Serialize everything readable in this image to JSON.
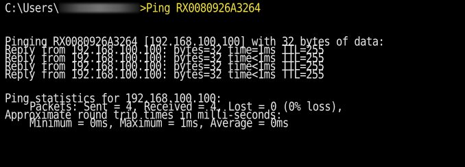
{
  "colors": {
    "background": "#000000",
    "text": "#e6e6e6",
    "command": "#f2e03a"
  },
  "prompt": {
    "path_prefix": "C:\\Users\\",
    "separator": ">",
    "command": "Ping RX0080926A3264"
  },
  "output": {
    "pinging": "Pinging RX0080926A3264 [192.168.100.100] with 32 bytes of data:",
    "replies": [
      "Reply from 192.168.100.100: bytes=32 time=1ms TTL=255",
      "Reply from 192.168.100.100: bytes=32 time<1ms TTL=255",
      "Reply from 192.168.100.100: bytes=32 time<1ms TTL=255",
      "Reply from 192.168.100.100: bytes=32 time<1ms TTL=255"
    ],
    "stats_header": "Ping statistics for 192.168.100.100:",
    "packets": "Packets: Sent = 4, Received = 4, Lost = 0 (0% loss),",
    "rtt_header": "Approximate round trip times in milli-seconds:",
    "rtt_values": "Minimum = 0ms, Maximum = 1ms, Average = 0ms"
  }
}
